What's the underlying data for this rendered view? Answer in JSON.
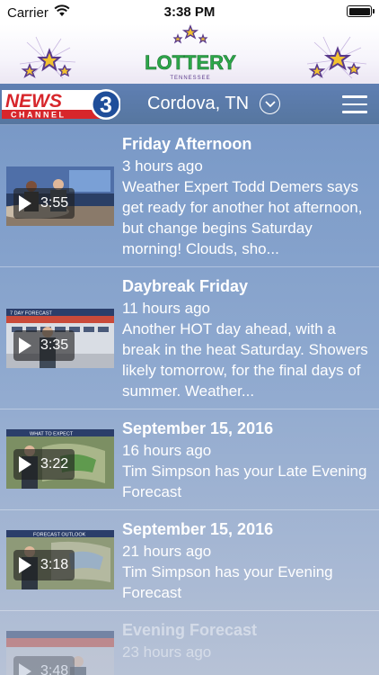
{
  "status_bar": {
    "carrier": "Carrier",
    "time": "3:38 PM"
  },
  "banner": {
    "logo_text": "LOTTERY",
    "logo_subtext": "TENNESSEE"
  },
  "header": {
    "station_logo_main": "NEWS",
    "station_logo_number": "3",
    "station_logo_sub": "CHANNEL",
    "location": "Cordova, TN"
  },
  "videos": [
    {
      "title": "Friday Afternoon",
      "time_ago": "3 hours ago",
      "description": "Weather Expert Todd Demers says get ready for another hot afternoon, but change begins Saturday morning!  Clouds, sho...",
      "duration": "3:55"
    },
    {
      "title": "Daybreak Friday",
      "time_ago": "11 hours ago",
      "description": "Another HOT day ahead, with a break in the heat Saturday. Showers likely tomorrow, for the final days of summer.  Weather...",
      "duration": "3:35",
      "thumb_caption": "7 DAY FORECAST"
    },
    {
      "title": "September 15, 2016",
      "time_ago": "16 hours ago",
      "description": "Tim Simpson has your Late Evening Forecast",
      "duration": "3:22",
      "thumb_caption": "WHAT TO EXPECT"
    },
    {
      "title": "September 15, 2016",
      "time_ago": "21 hours ago",
      "description": "Tim Simpson has your Evening Forecast",
      "duration": "3:18",
      "thumb_caption": "FORECAST OUTLOOK"
    },
    {
      "title": "Evening Forecast",
      "time_ago": "23 hours ago",
      "description": "",
      "duration": "3:48"
    }
  ],
  "colors": {
    "accent_red": "#d7262b",
    "header_blue": "#5f7fb3",
    "lottery_green": "#2da84a",
    "star_purple": "#5a3a8c",
    "star_gold": "#f2c230"
  }
}
